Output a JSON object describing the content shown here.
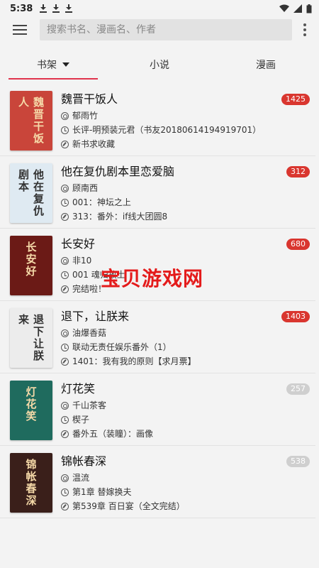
{
  "status": {
    "time": "5:38"
  },
  "search": {
    "placeholder": "搜索书名、漫画名、作者"
  },
  "tabs": [
    {
      "label": "书架",
      "active": true
    },
    {
      "label": "小说",
      "active": false
    },
    {
      "label": "漫画",
      "active": false
    }
  ],
  "books": [
    {
      "title": "魏晋干饭人",
      "author": "郁雨竹",
      "latest": "长评-明预装元君（书友20180614194919701）",
      "update": "新书求收藏",
      "badge": "1425",
      "badge_style": "red",
      "cover_text": "魏晋干饭人",
      "cover_color": "#c9453a"
    },
    {
      "title": "他在复仇剧本里恋爱脑",
      "author": "顾南西",
      "latest": "001：神坛之上",
      "update": "313：番外：if线大团圆8",
      "badge": "312",
      "badge_style": "red",
      "cover_text": "他在复仇剧本",
      "cover_color": "#dfeaf2"
    },
    {
      "title": "长安好",
      "author": "非10",
      "latest": "001 魂归故土",
      "update": "完结啦！",
      "badge": "680",
      "badge_style": "red",
      "cover_text": "长安好",
      "cover_color": "#6b1a16"
    },
    {
      "title": "退下，让朕来",
      "author": "油爆香菇",
      "latest": "联动无责任娱乐番外（1）",
      "update": "1401：我有我的原则【求月票】",
      "badge": "1403",
      "badge_style": "red",
      "cover_text": "退下让朕来",
      "cover_color": "#ececec"
    },
    {
      "title": "灯花笑",
      "author": "千山茶客",
      "latest": "楔子",
      "update": "番外五（装瞳）：画像",
      "badge": "257",
      "badge_style": "grey",
      "cover_text": "灯花笑",
      "cover_color": "#1f6b5e"
    },
    {
      "title": "锦帐春深",
      "author": "温流",
      "latest": "第1章 替嫁换夫",
      "update": "第539章 百日宴（全文完结）",
      "badge": "538",
      "badge_style": "grey",
      "cover_text": "锦帐春深",
      "cover_color": "#3a1f1a"
    }
  ],
  "watermark": "宝贝游戏网"
}
